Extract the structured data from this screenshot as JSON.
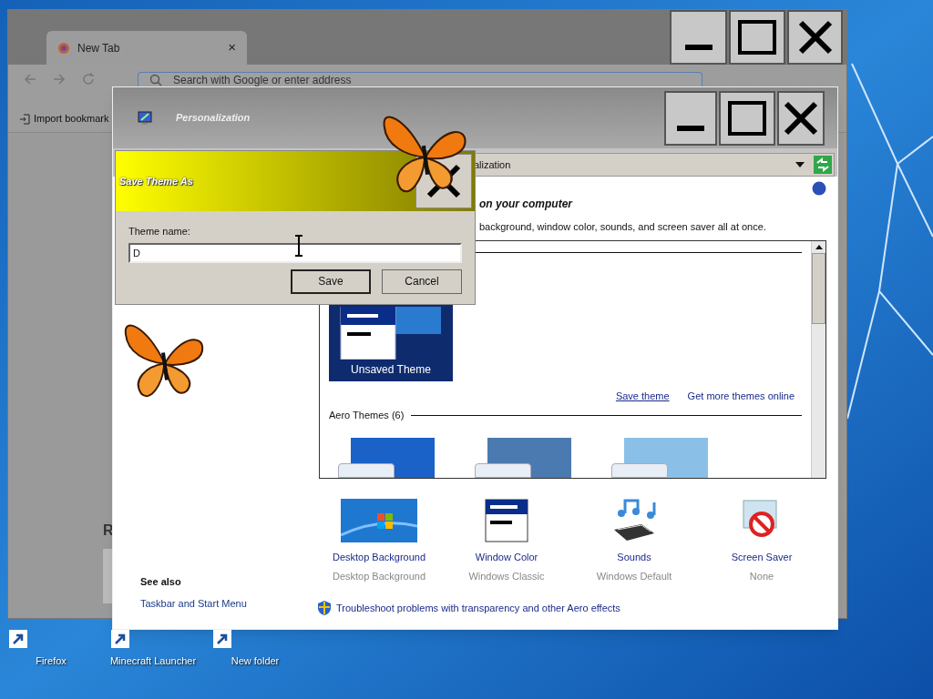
{
  "browser": {
    "tab": {
      "title": "New Tab",
      "close": "×",
      "selected": true
    },
    "address_placeholder": "Search with Google or enter address",
    "bookmark": "Import bookmark",
    "content_heading": "R"
  },
  "personalization": {
    "title": "Personalization",
    "breadcrumb": "alization",
    "heading": "on your computer",
    "description": "background, window color, sounds, and screen saver all at once.",
    "current_theme": {
      "label": "Unsaved Theme",
      "selected": true
    },
    "links": [
      "Save theme",
      "Get more themes online"
    ],
    "aero_header": "Aero Themes (6)",
    "settings": [
      {
        "kind": "background",
        "label": "Desktop Background",
        "value": "Desktop Background"
      },
      {
        "kind": "color",
        "label": "Window Color",
        "value": "Windows Classic"
      },
      {
        "kind": "sounds",
        "label": "Sounds",
        "value": "Windows Default"
      },
      {
        "kind": "saver",
        "label": "Screen Saver",
        "value": "None"
      }
    ],
    "see_also_title": "See also",
    "see_also_links": [
      "Taskbar and Start Menu"
    ],
    "troubleshoot": "Troubleshoot problems with transparency and other Aero effects"
  },
  "dialog": {
    "title": "Save Theme As",
    "field_label": "Theme name:",
    "value": "D",
    "buttons": [
      "Save",
      "Cancel"
    ]
  },
  "desktop_icons": [
    {
      "label": "Firefox"
    },
    {
      "label": "Minecraft Launcher"
    },
    {
      "label": "New folder"
    }
  ]
}
